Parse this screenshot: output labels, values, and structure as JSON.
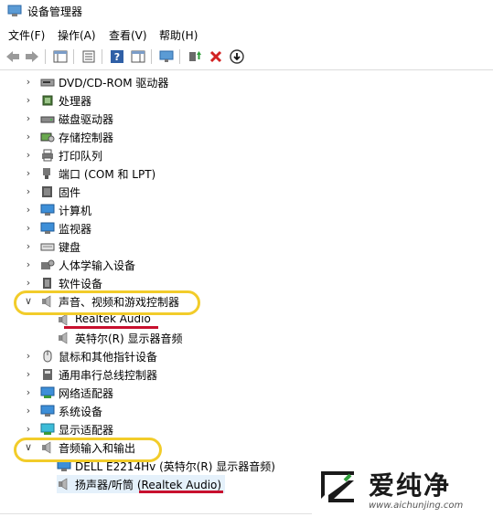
{
  "window": {
    "title": "设备管理器"
  },
  "menu": [
    "文件(F)",
    "操作(A)",
    "查看(V)",
    "帮助(H)"
  ],
  "tree": [
    {
      "label": "DVD/CD-ROM 驱动器",
      "icon": "disc-drive-icon",
      "expanded": false
    },
    {
      "label": "处理器",
      "icon": "processor-icon",
      "expanded": false
    },
    {
      "label": "磁盘驱动器",
      "icon": "disk-drive-icon",
      "expanded": false
    },
    {
      "label": "存储控制器",
      "icon": "storage-controller-icon",
      "expanded": false
    },
    {
      "label": "打印队列",
      "icon": "printer-icon",
      "expanded": false
    },
    {
      "label": "端口 (COM 和 LPT)",
      "icon": "port-icon",
      "expanded": false
    },
    {
      "label": "固件",
      "icon": "firmware-icon",
      "expanded": false
    },
    {
      "label": "计算机",
      "icon": "computer-icon",
      "expanded": false
    },
    {
      "label": "监视器",
      "icon": "monitor-icon",
      "expanded": false
    },
    {
      "label": "键盘",
      "icon": "keyboard-icon",
      "expanded": false
    },
    {
      "label": "人体学输入设备",
      "icon": "hid-icon",
      "expanded": false
    },
    {
      "label": "软件设备",
      "icon": "software-device-icon",
      "expanded": false
    },
    {
      "label": "声音、视频和游戏控制器",
      "icon": "speaker-icon",
      "expanded": true
    },
    {
      "label": "Realtek Audio",
      "icon": "speaker-icon",
      "child": true
    },
    {
      "label": "英特尔(R) 显示器音频",
      "icon": "speaker-icon",
      "child": true
    },
    {
      "label": "鼠标和其他指针设备",
      "icon": "mouse-icon",
      "expanded": false
    },
    {
      "label": "通用串行总线控制器",
      "icon": "usb-icon",
      "expanded": false
    },
    {
      "label": "网络适配器",
      "icon": "network-adapter-icon",
      "expanded": false
    },
    {
      "label": "系统设备",
      "icon": "system-device-icon",
      "expanded": false
    },
    {
      "label": "显示适配器",
      "icon": "display-adapter-icon",
      "expanded": false
    },
    {
      "label": "音频输入和输出",
      "icon": "speaker-icon",
      "expanded": true
    },
    {
      "label": "DELL E2214Hv (英特尔(R) 显示器音频)",
      "icon": "monitor-icon",
      "child": true
    },
    {
      "label": "扬声器/听筒 (Realtek Audio)",
      "icon": "speaker-icon",
      "child": true,
      "selected": true
    }
  ],
  "watermark": {
    "text": "爱纯净",
    "url": "www.aichunjing.com"
  },
  "colors": {
    "highlight": "#f2cc2a",
    "underline": "#c8102e",
    "selection": "#e5f1fb"
  }
}
